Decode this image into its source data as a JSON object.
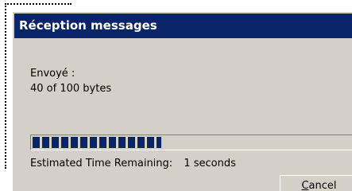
{
  "dialog": {
    "title": "Réception messages",
    "sent_label": "Envoyé :",
    "sent_value": "40 of 100 bytes",
    "progress": {
      "value": 40,
      "max": 100
    },
    "eta_label": "Estimated Time Remaining:",
    "eta_value": "1 seconds",
    "cancel_accel": "C",
    "cancel_rest": "ancel"
  },
  "colors": {
    "titlebar": "#0a246a",
    "window": "#d4d0c8",
    "progress_fill": "#0a246a"
  }
}
